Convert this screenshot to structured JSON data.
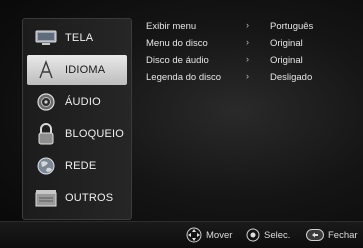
{
  "sidebar": {
    "items": [
      {
        "label": "TELA",
        "icon": "monitor-icon",
        "active": false
      },
      {
        "label": "IDIOMA",
        "icon": "language-icon",
        "active": true
      },
      {
        "label": "ÁUDIO",
        "icon": "speaker-icon",
        "active": false
      },
      {
        "label": "BLOQUEIO",
        "icon": "lock-icon",
        "active": false
      },
      {
        "label": "REDE",
        "icon": "globe-icon",
        "active": false
      },
      {
        "label": "OUTROS",
        "icon": "box-icon",
        "active": false
      }
    ]
  },
  "settings": {
    "rows": [
      {
        "label": "Exibir menu",
        "value": "Português"
      },
      {
        "label": "Menu do disco",
        "value": "Original"
      },
      {
        "label": "Disco de áudio",
        "value": "Original"
      },
      {
        "label": "Legenda do disco",
        "value": "Desligado"
      }
    ],
    "arrow": "›"
  },
  "footer": {
    "move": "Mover",
    "select": "Selec.",
    "close": "Fechar"
  }
}
